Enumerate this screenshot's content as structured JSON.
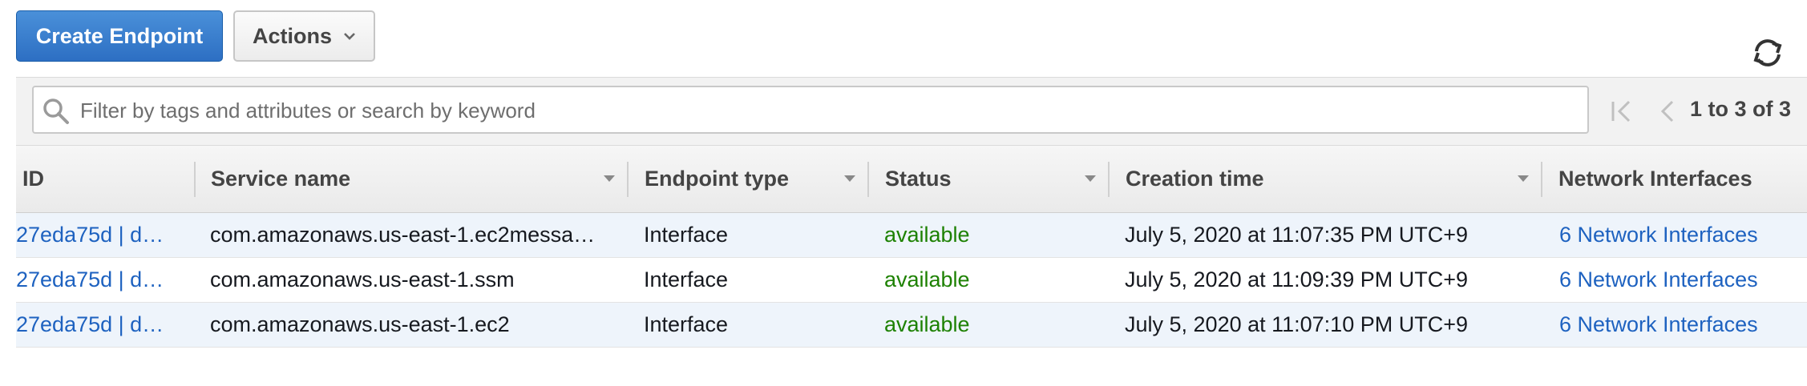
{
  "toolbar": {
    "create_label": "Create Endpoint",
    "actions_label": "Actions",
    "refresh_icon": "refresh-icon"
  },
  "filter": {
    "placeholder": "Filter by tags and attributes or search by keyword",
    "pagination": "1 to 3 of 3",
    "icons": [
      "search-icon",
      "first-page-icon",
      "previous-page-icon"
    ]
  },
  "table": {
    "columns": [
      "ID",
      "Service name",
      "Endpoint type",
      "Status",
      "Creation time",
      "Network Interfaces"
    ],
    "rows": [
      {
        "id": "27eda75d | d…",
        "service": "com.amazonaws.us-east-1.ec2messa…",
        "type": "Interface",
        "status": "available",
        "created": "July 5, 2020 at 11:07:35 PM UTC+9",
        "nics": "6 Network Interfaces"
      },
      {
        "id": "27eda75d | d…",
        "service": "com.amazonaws.us-east-1.ssm",
        "type": "Interface",
        "status": "available",
        "created": "July 5, 2020 at 11:09:39 PM UTC+9",
        "nics": "6 Network Interfaces"
      },
      {
        "id": "27eda75d | d…",
        "service": "com.amazonaws.us-east-1.ec2",
        "type": "Interface",
        "status": "available",
        "created": "July 5, 2020 at 11:07:10 PM UTC+9",
        "nics": "6 Network Interfaces"
      }
    ]
  },
  "colors": {
    "primary_button": "#2d6fc3",
    "link": "#1e62c0",
    "status_available": "#1d8102",
    "selected_row": "#eef4fb"
  }
}
